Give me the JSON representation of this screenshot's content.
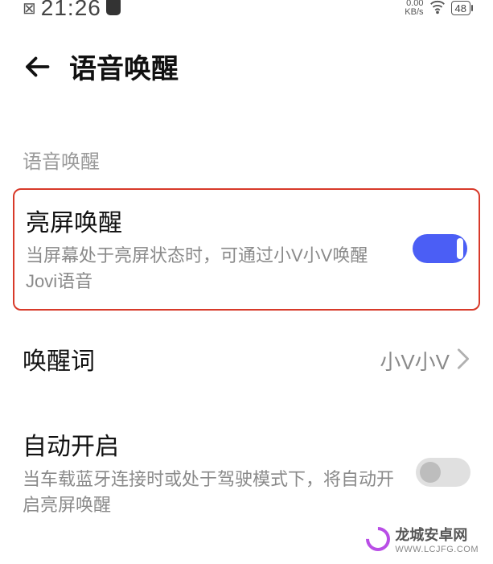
{
  "status_bar": {
    "time": "21:26",
    "data_rate_top": "0.00",
    "data_rate_bottom": "KB/s",
    "battery_level": "48"
  },
  "header": {
    "title": "语音唤醒"
  },
  "section_label": "语音唤醒",
  "settings": {
    "screen_on_wake": {
      "title": "亮屏唤醒",
      "desc": "当屏幕处于亮屏状态时，可通过小V小V唤醒Jovi语音",
      "enabled": true
    },
    "wake_word": {
      "title": "唤醒词",
      "value": "小V小V"
    },
    "auto_enable": {
      "title": "自动开启",
      "desc": "当车载蓝牙连接时或处于驾驶模式下，将自动开启亮屏唤醒",
      "enabled": false
    }
  },
  "watermark": {
    "text": "龙城安卓网",
    "sub": "WWW.LCJFG.COM"
  }
}
